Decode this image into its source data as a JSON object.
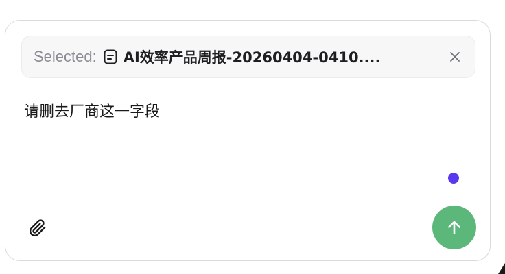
{
  "composer": {
    "selection": {
      "prefix": "Selected:",
      "icon": "document-icon",
      "filename": "AI效率产品周报-20260404-0410....",
      "close_icon": "close-icon"
    },
    "message": "请删去厂商这一字段",
    "attach_icon": "paperclip-icon",
    "send_icon": "arrow-up-icon",
    "colors": {
      "send_button": "#5cb87a",
      "status_dot": "#5a38f0",
      "chip_background": "#f7f7f8",
      "border": "#d9dadd"
    }
  }
}
